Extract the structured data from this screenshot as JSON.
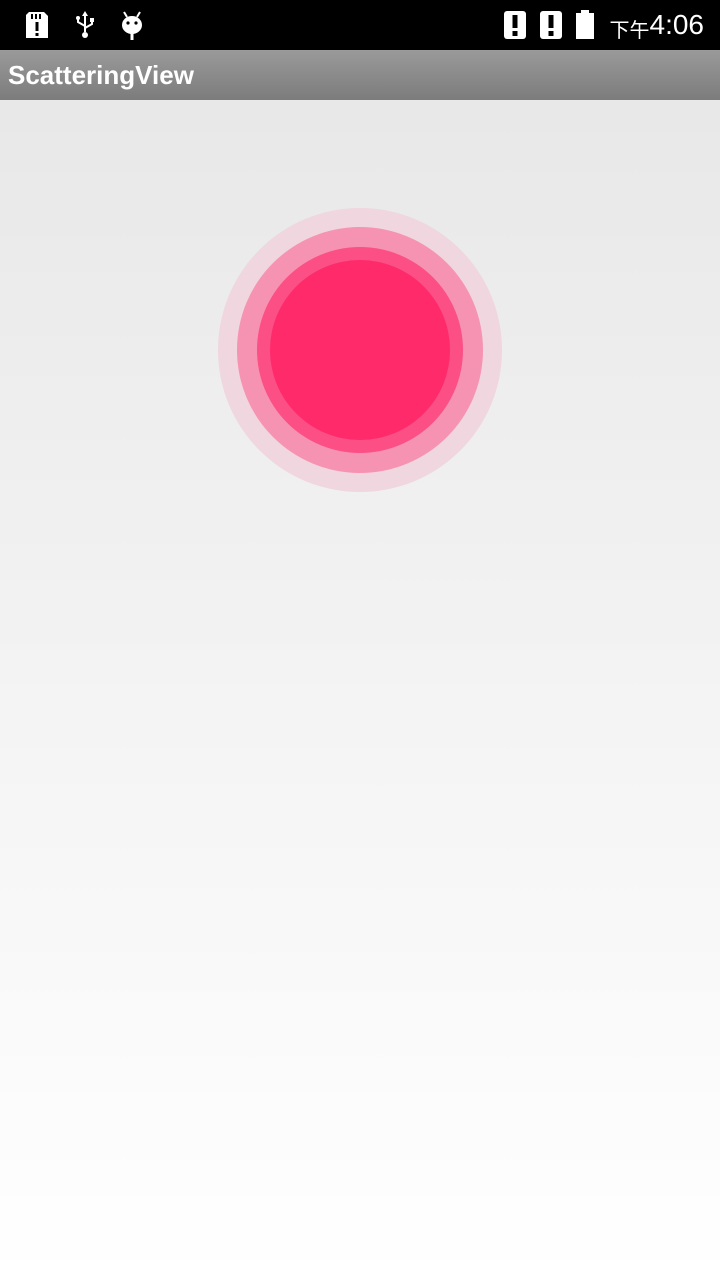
{
  "status_bar": {
    "left_icons": [
      "sd-card-alert-icon",
      "usb-icon",
      "android-debug-icon"
    ],
    "right_icons": [
      "signal-alert-icon",
      "signal-alert-icon",
      "battery-icon"
    ],
    "time_prefix": "下午",
    "time": "4:06"
  },
  "action_bar": {
    "title": "ScatteringView"
  },
  "scatter_view": {
    "colors": {
      "outer": "#f0d6de",
      "middle": "#f693b2",
      "inner": "#fb4f86",
      "core": "#ff2a6a"
    }
  }
}
